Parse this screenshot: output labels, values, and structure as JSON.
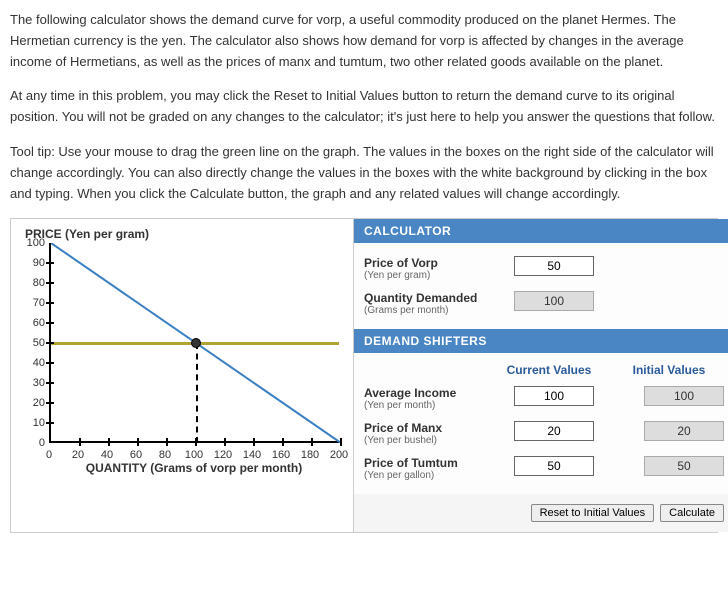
{
  "intro": {
    "p1": "The following calculator shows the demand curve for vorp, a useful commodity produced on the planet Hermes. The Hermetian currency is the yen. The calculator also shows how demand for vorp is affected by changes in the average income of Hermetians, as well as the prices of manx and tumtum, two other related goods available on the planet.",
    "p2": "At any time in this problem, you may click the Reset to Initial Values button to return the demand curve to its original position. You will not be graded on any changes to the calculator; it's just here to help you answer the questions that follow.",
    "p3": "Tool tip: Use your mouse to drag the green line on the graph. The values in the boxes on the right side of the calculator will change accordingly. You can also directly change the values in the boxes with the white background by clicking in the box and typing. When you click the Calculate button, the graph and any related values will change accordingly."
  },
  "chart_data": {
    "type": "line",
    "title_y": "PRICE (Yen per gram)",
    "title_x": "QUANTITY (Grams of vorp per month)",
    "y_ticks": [
      100,
      90,
      80,
      70,
      60,
      50,
      40,
      30,
      20,
      10,
      0
    ],
    "x_ticks": [
      0,
      20,
      40,
      60,
      80,
      100,
      120,
      140,
      160,
      180,
      200
    ],
    "ylim": [
      0,
      100
    ],
    "xlim": [
      0,
      200
    ],
    "demand_line": {
      "x": [
        0,
        200
      ],
      "y": [
        100,
        0
      ]
    },
    "price_line_y": 50,
    "equilibrium": {
      "x": 100,
      "y": 50
    }
  },
  "calculator": {
    "header": "CALCULATOR",
    "price_label": "Price of Vorp",
    "price_sub": "(Yen per gram)",
    "price_value": "50",
    "qty_label": "Quantity Demanded",
    "qty_sub": "(Grams per month)",
    "qty_value": "100"
  },
  "shifters": {
    "header": "DEMAND SHIFTERS",
    "col_current": "Current Values",
    "col_initial": "Initial Values",
    "rows": [
      {
        "label": "Average Income",
        "sub": "(Yen per month)",
        "current": "100",
        "initial": "100"
      },
      {
        "label": "Price of Manx",
        "sub": "(Yen per bushel)",
        "current": "20",
        "initial": "20"
      },
      {
        "label": "Price of Tumtum",
        "sub": "(Yen per gallon)",
        "current": "50",
        "initial": "50"
      }
    ]
  },
  "buttons": {
    "reset": "Reset to Initial Values",
    "calc": "Calculate"
  }
}
